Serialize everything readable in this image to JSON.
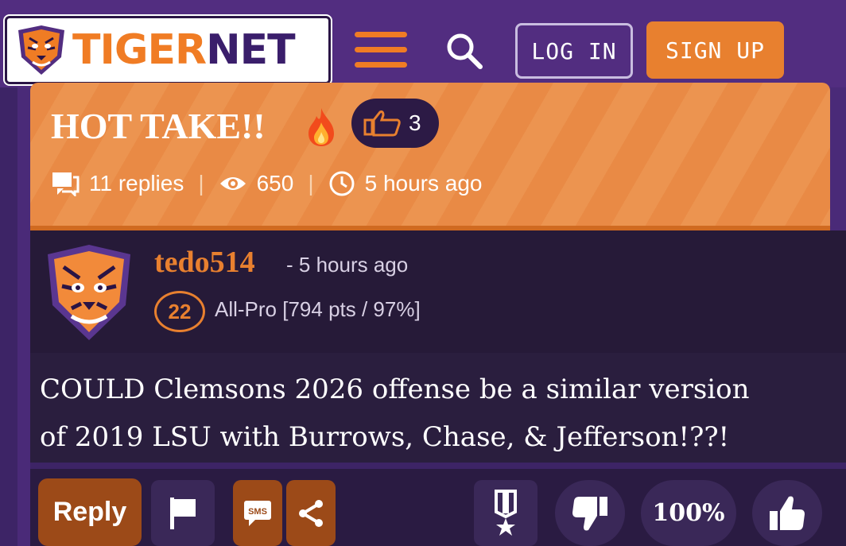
{
  "header": {
    "logo_part1": "TIGER",
    "logo_part2": "NET",
    "login_label": "LOG IN",
    "signup_label": "SIGN UP"
  },
  "post": {
    "title": "HOT TAKE!!",
    "likes": "3",
    "replies": "11 replies",
    "views": "650",
    "posted": "5 hours ago"
  },
  "author": {
    "username": "tedo514",
    "time": "- 5 hours ago",
    "rank": "22",
    "rank_text": "All-Pro [794 pts / 97%]"
  },
  "body": {
    "line1": "COULD Clemsons 2026 offense be a similar version",
    "line2": "of 2019 LSU with Burrows, Chase, & Jefferson!??!"
  },
  "actions": {
    "reply_label": "Reply",
    "sms_label": "SMS",
    "vote_percent": "100%"
  },
  "colors": {
    "purple": "#522d80",
    "orange": "#e8802f",
    "dark": "#261a38"
  }
}
